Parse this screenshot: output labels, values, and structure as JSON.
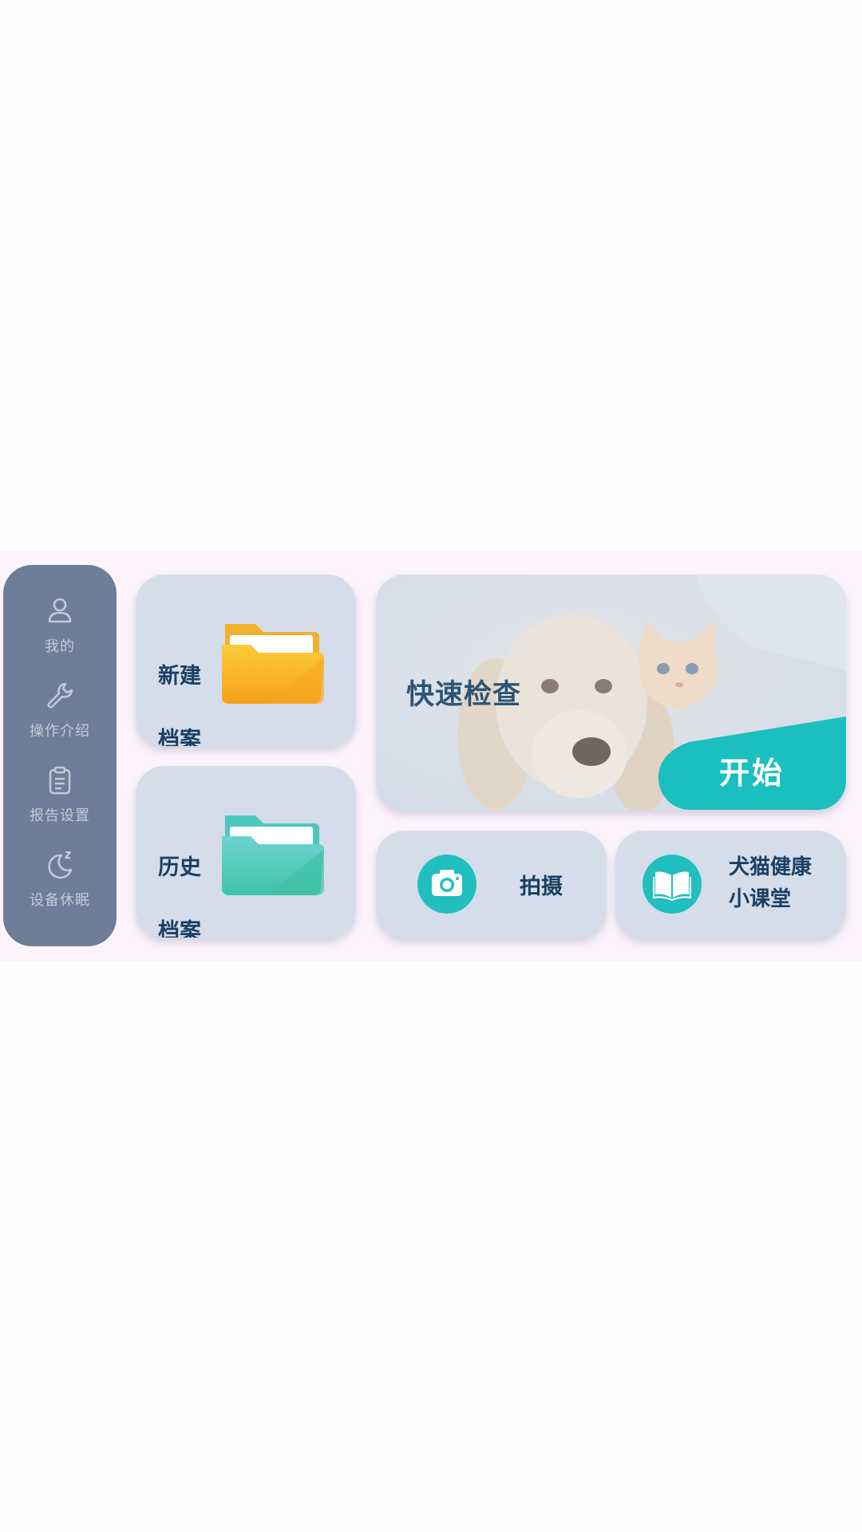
{
  "sidebar": {
    "items": [
      {
        "label": "我的",
        "icon": "user-icon"
      },
      {
        "label": "操作介绍",
        "icon": "wrench-icon"
      },
      {
        "label": "报告设置",
        "icon": "clipboard-icon"
      },
      {
        "label": "设备休眠",
        "icon": "moon-sleep-icon"
      }
    ]
  },
  "cards": {
    "new_record": {
      "line1": "新建",
      "line2": "档案",
      "icon": "folder-icon",
      "color": "#f7a823"
    },
    "history_record": {
      "line1": "历史",
      "line2": "档案",
      "icon": "folder-icon",
      "color": "#3ec6b6"
    },
    "quick_check": {
      "title": "快速检查",
      "start_label": "开始",
      "accent": "#1bbfbf"
    },
    "photo": {
      "label": "拍摄",
      "icon": "camera-icon"
    },
    "course": {
      "line1": "犬猫健康",
      "line2": "小课堂",
      "icon": "book-icon"
    }
  },
  "colors": {
    "sidebar_bg": "#6e7e98",
    "card_bg": "#d4dde9",
    "text_dark": "#1b3f63",
    "teal": "#21bfbd"
  }
}
